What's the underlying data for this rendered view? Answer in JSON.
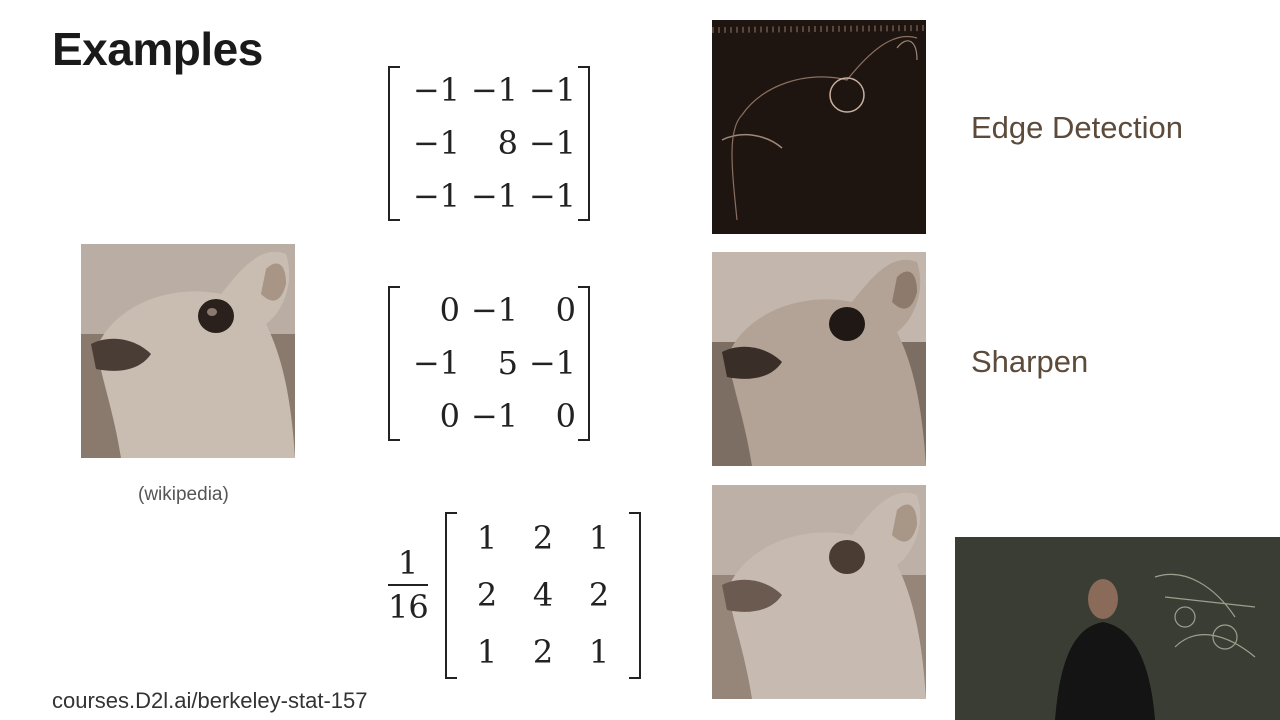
{
  "slide": {
    "title": "Examples",
    "credit": "(wikipedia)",
    "footer": "courses.D2l.ai/berkeley-stat-157"
  },
  "kernels": [
    {
      "label": "Edge Detection",
      "scale": "",
      "rows": [
        [
          "−1",
          "−1",
          "−1"
        ],
        [
          "−1",
          "8",
          "−1"
        ],
        [
          "−1",
          "−1",
          "−1"
        ]
      ]
    },
    {
      "label": "Sharpen",
      "scale": "",
      "rows": [
        [
          "0",
          "−1",
          "0"
        ],
        [
          "−1",
          "5",
          "−1"
        ],
        [
          "0",
          "−1",
          "0"
        ]
      ]
    },
    {
      "label": "",
      "scale_numerator": "1",
      "scale_denominator": "16",
      "rows": [
        [
          "1",
          "2",
          "1"
        ],
        [
          "2",
          "4",
          "2"
        ],
        [
          "1",
          "2",
          "1"
        ]
      ]
    }
  ]
}
